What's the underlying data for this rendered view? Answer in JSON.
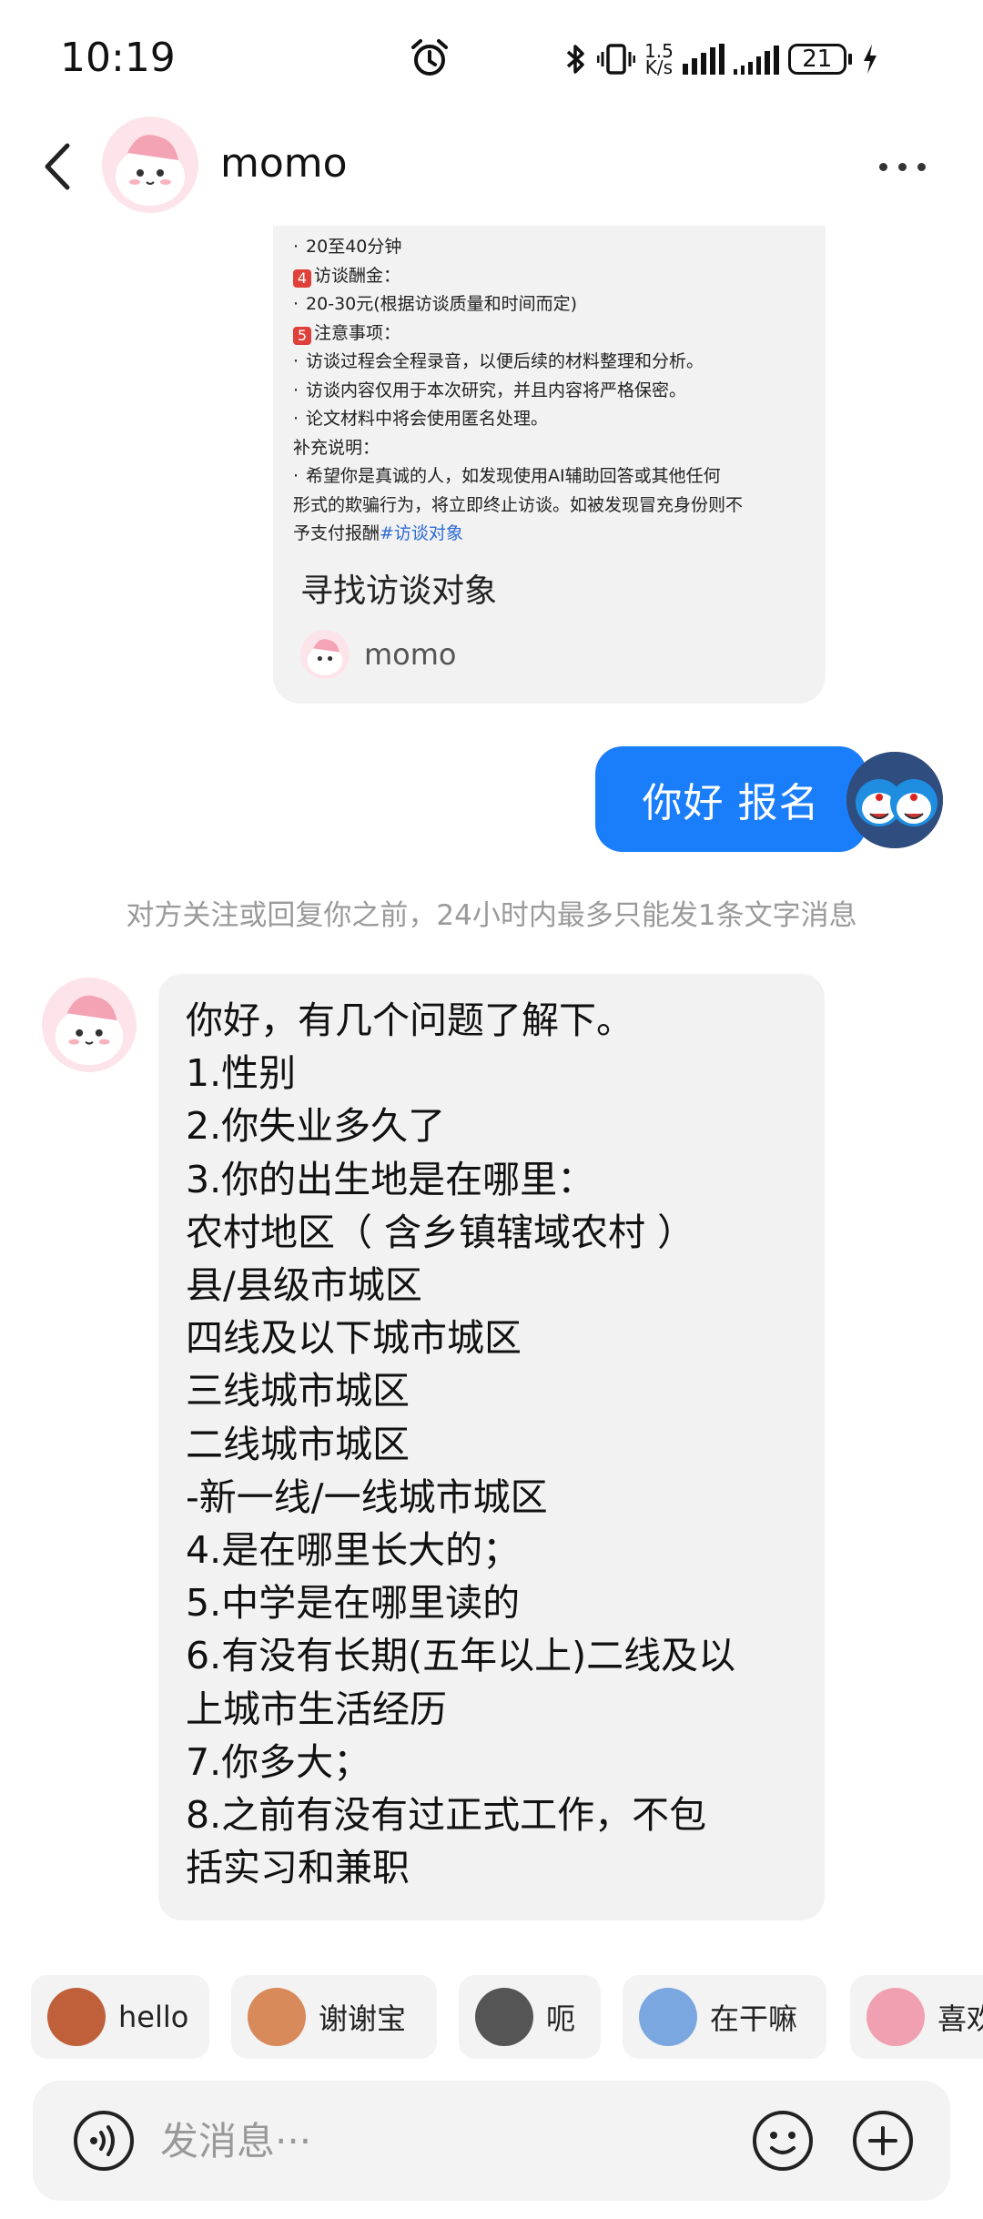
{
  "status_bar": {
    "time": "10:19",
    "net_speed_value": "1.5",
    "net_speed_unit": "K/s",
    "battery": "21"
  },
  "header": {
    "title": "momo"
  },
  "shared_card": {
    "lines": [
      {
        "bullet": "·",
        "text": "20至40分钟"
      },
      {
        "num": "4",
        "text": "访谈酬金："
      },
      {
        "bullet": "·",
        "text": "20-30元(根据访谈质量和时间而定)"
      },
      {
        "num": "5",
        "text": "注意事项："
      },
      {
        "bullet": "·",
        "text": "访谈过程会全程录音，以便后续的材料整理和分析。"
      },
      {
        "bullet": "·",
        "text": "访谈内容仅用于本次研究，并且内容将严格保密。"
      },
      {
        "bullet": "·",
        "text": "论文材料中将会使用匿名处理。"
      },
      {
        "text": "补充说明："
      },
      {
        "bullet": "·",
        "text": "希望你是真诚的人，如发现使用AI辅助回答或其他任何"
      },
      {
        "text": "形式的欺骗行为，将立即终止访谈。如被发现冒充身份则不"
      }
    ],
    "last_line_text": "予支付报酬",
    "hashtag": "#访谈对象",
    "title": "寻找访谈对象",
    "author": "momo"
  },
  "outgoing_message": "你好 报名",
  "notice": "对方关注或回复你之前，24小时内最多只能发1条文字消息",
  "incoming_message": {
    "lines": [
      "你好，有几个问题了解下。",
      "1.性别",
      "2.你失业多久了",
      "3.你的出生地是在哪里：",
      "农村地区（ 含乡镇辖域农村 ）",
      "县/县级市城区",
      "四线及以下城市城区",
      "三线城市城区",
      "二线城市城区",
      "-新一线/一线城市城区",
      "4.是在哪里长大的；",
      "5.中学是在哪里读的",
      "6.有没有长期(五年以上)二线及以",
      "上城市生活经历",
      "7.你多大；",
      "8.之前有没有过正式工作，不包",
      "括实习和兼职"
    ]
  },
  "quick_replies": [
    {
      "label": "hello",
      "icon": "monkey-emoji-icon",
      "color": "#c0603a"
    },
    {
      "label": "谢谢宝",
      "icon": "rose-emoji-icon",
      "color": "#d98a5a"
    },
    {
      "label": "呃",
      "icon": "cat-emoji-icon",
      "color": "#555555"
    },
    {
      "label": "在干嘛",
      "icon": "magnifier-emoji-icon",
      "color": "#7aa7e0"
    },
    {
      "label": "喜欢",
      "icon": "pig-emoji-icon",
      "color": "#f0a0b0"
    }
  ],
  "input": {
    "placeholder": "发消息···"
  },
  "colors": {
    "accent_blue": "#1a7efb",
    "bubble_gray": "#f2f2f2",
    "notice_gray": "#9a9a9a"
  }
}
